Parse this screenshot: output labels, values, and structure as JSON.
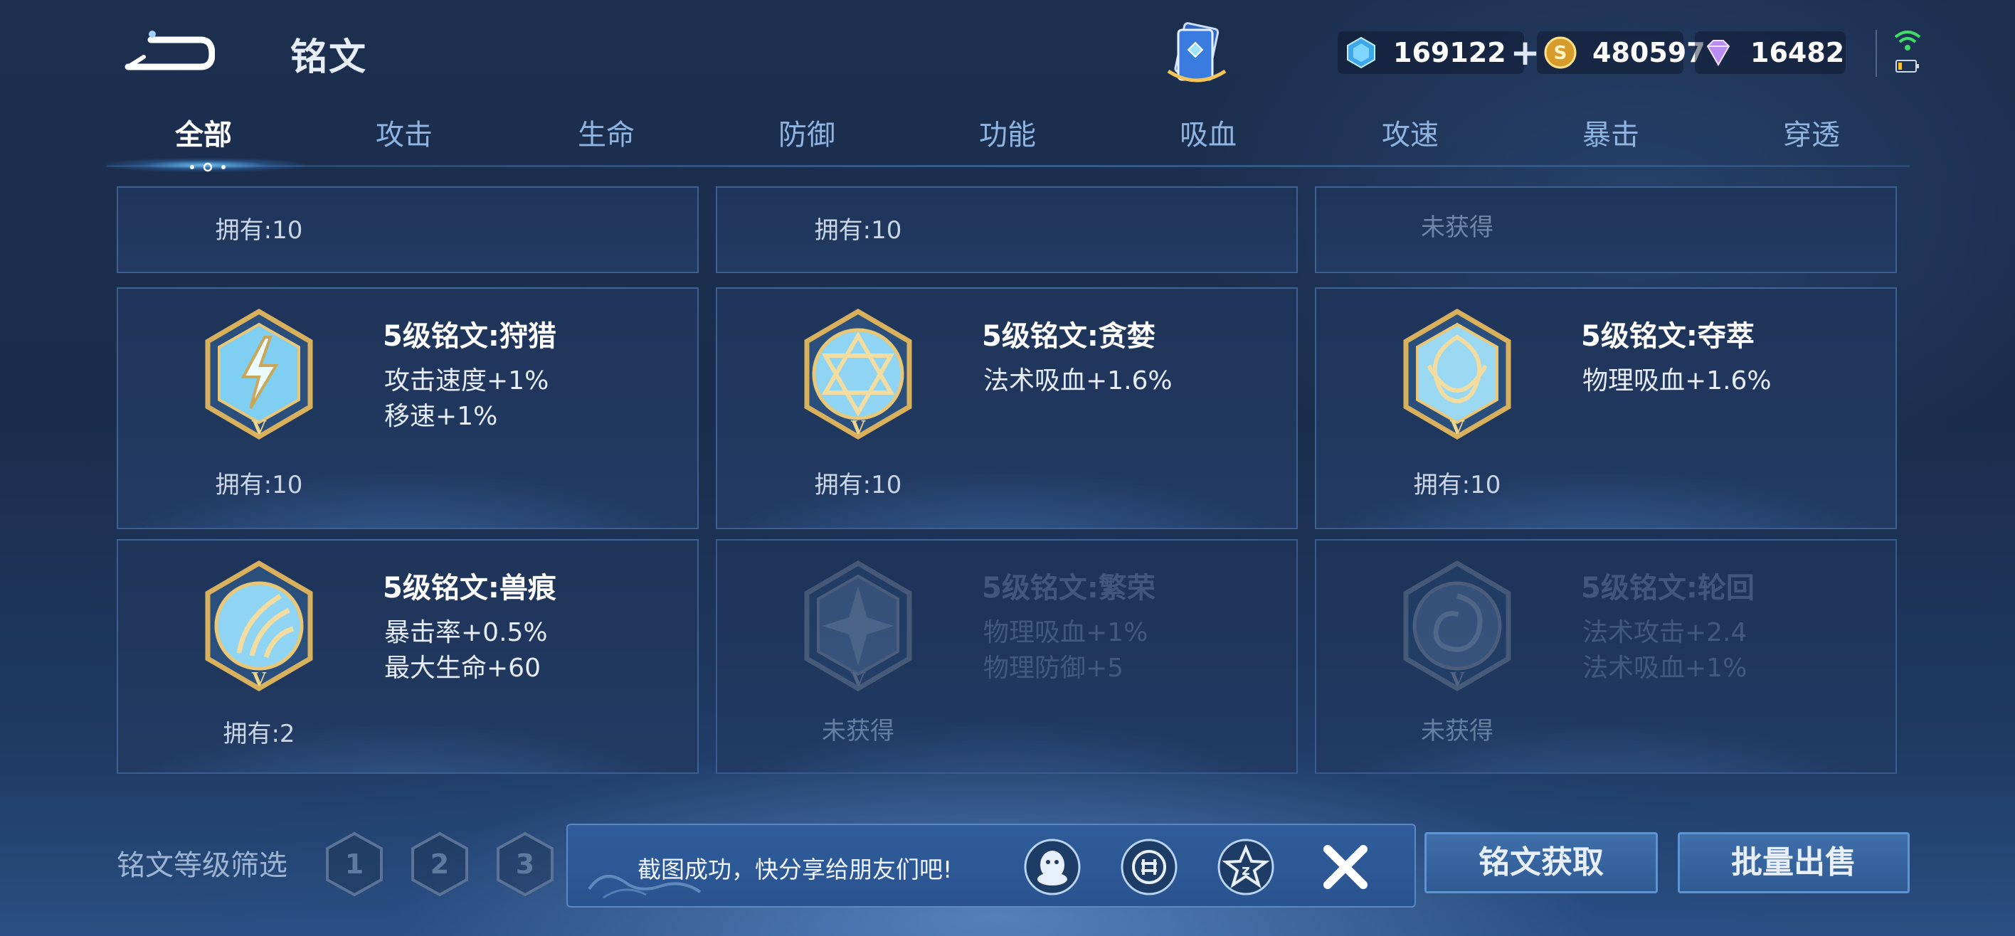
{
  "header": {
    "title": "铭文",
    "currencies": [
      {
        "icon": "diamond-icon",
        "value": "169122"
      },
      {
        "icon": "gold-coin-icon",
        "value": "480597"
      },
      {
        "icon": "gem-icon",
        "value": "16482"
      }
    ],
    "plus_label": "+"
  },
  "tabs": [
    {
      "label": "全部",
      "active": true
    },
    {
      "label": "攻击"
    },
    {
      "label": "生命"
    },
    {
      "label": "防御"
    },
    {
      "label": "功能"
    },
    {
      "label": "吸血"
    },
    {
      "label": "攻速"
    },
    {
      "label": "暴击"
    },
    {
      "label": "穿透"
    }
  ],
  "partial_row": [
    {
      "owned": "拥有:10"
    },
    {
      "owned": "拥有:10"
    },
    {
      "owned": "未获得"
    }
  ],
  "runes": [
    {
      "name": "5级铭文:狩猎",
      "stats": [
        "攻击速度+1%",
        "移速+1%"
      ],
      "owned": "拥有:10",
      "icon": "lightning-rune-icon"
    },
    {
      "name": "5级铭文:贪婪",
      "stats": [
        "法术吸血+1.6%",
        ""
      ],
      "owned": "拥有:10",
      "icon": "star-rune-icon"
    },
    {
      "name": "5级铭文:夺萃",
      "stats": [
        "物理吸血+1.6%",
        ""
      ],
      "owned": "拥有:10",
      "icon": "knot-rune-icon"
    },
    {
      "name": "5级铭文:兽痕",
      "stats": [
        "暴击率+0.5%",
        "最大生命+60"
      ],
      "owned": "拥有:2",
      "icon": "claw-rune-icon"
    },
    {
      "name": "5级铭文:繁荣",
      "stats": [
        "物理吸血+1%",
        "物理防御+5"
      ],
      "owned": "未获得",
      "icon": "flower-rune-icon"
    },
    {
      "name": "5级铭文:轮回",
      "stats": [
        "法术攻击+2.4",
        "法术吸血+1%"
      ],
      "owned": "未获得",
      "icon": "swirl-rune-icon"
    }
  ],
  "filter": {
    "label": "铭文等级筛选",
    "levels": [
      "1",
      "2",
      "3"
    ]
  },
  "toast": {
    "text": "截图成功，快分享给朋友们吧!",
    "share_targets": [
      "qq-icon",
      "wechat-moments-icon",
      "qzone-icon"
    ]
  },
  "actions": {
    "get_label": "铭文获取",
    "sell_label": "批量出售"
  }
}
